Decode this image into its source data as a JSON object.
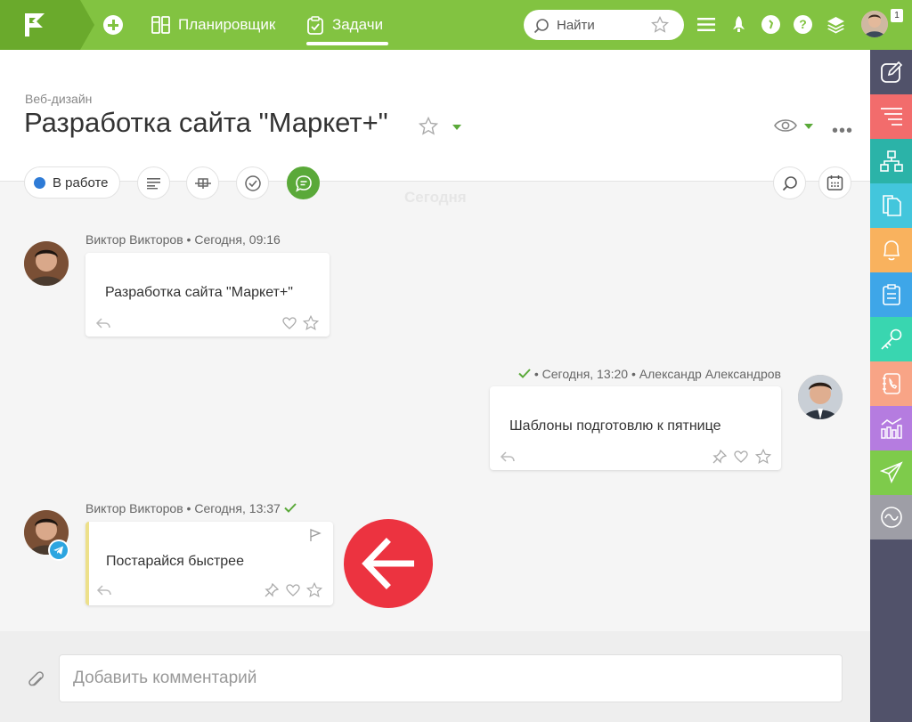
{
  "topbar": {
    "nav": [
      {
        "label": "Планировщик"
      },
      {
        "label": "Задачи"
      }
    ],
    "search_placeholder": "Найти",
    "notification_count": "1",
    "help_glyph": "?"
  },
  "task": {
    "breadcrumb": "Веб-дизайн",
    "title": "Разработка сайта \"Маркет+\"",
    "status": "В работе",
    "status_color": "#2e7bd6",
    "more_glyph": "•••"
  },
  "feed": {
    "day_label": "Сегодня",
    "messages": [
      {
        "author": "Виктор Викторов",
        "sep": "•",
        "time": "Сегодня, 09:16",
        "text": "Разработка сайта \"Маркет+\""
      },
      {
        "author": "Александр Александров",
        "sep": "•",
        "time": "Сегодня, 13:20",
        "text": "Шаблоны подготовлю к пятнице"
      },
      {
        "author": "Виктор Викторов",
        "sep": "•",
        "time": "Сегодня, 13:37",
        "text": "Постарайся быстрее"
      }
    ]
  },
  "composer": {
    "placeholder": "Добавить комментарий"
  },
  "colors": {
    "topbar": "#82c341",
    "accent": "#5aa939",
    "sidebar": "#51526a",
    "highlight_arrow": "#ec3340"
  },
  "sidebar_icons": [
    "edit-icon",
    "list-icon",
    "structure-icon",
    "documents-icon",
    "bell-icon",
    "notes-icon",
    "key-icon",
    "phone-book-icon",
    "analytics-icon",
    "send-icon",
    "wave-icon"
  ]
}
